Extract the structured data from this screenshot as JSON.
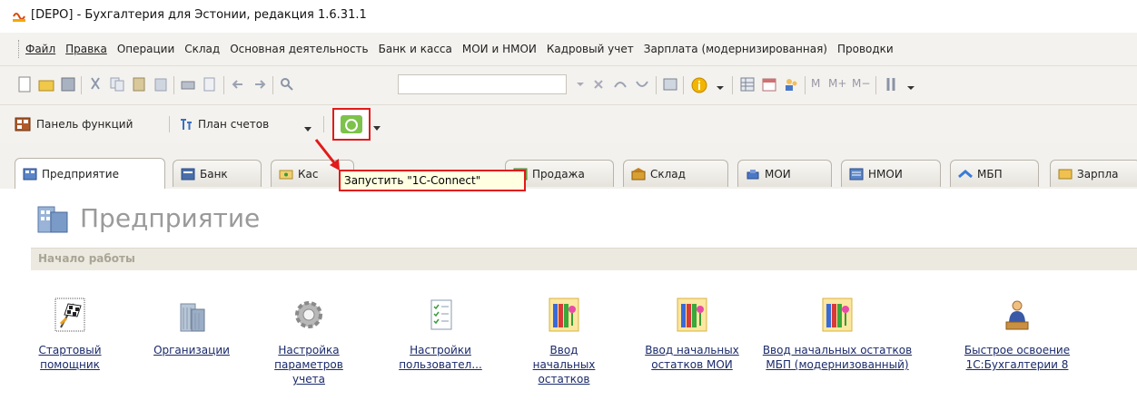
{
  "window": {
    "title": "[DEPO] - Бухгалтерия для Эстонии, редакция 1.6.31.1"
  },
  "menu": {
    "items": [
      "Файл",
      "Правка",
      "Операции",
      "Склад",
      "Основная деятельность",
      "Банк и касса",
      "МОИ и НМОИ",
      "Кадровый учет",
      "Зарплата (модернизированная)",
      "Проводки"
    ]
  },
  "toolbar": {
    "search_value": "",
    "m_buttons": [
      "M",
      "M+",
      "M−"
    ]
  },
  "funcbar": {
    "function_panel_label": "Панель функций",
    "chart_of_accounts_label": "План счетов"
  },
  "tooltip": {
    "text": "Запустить \"1С-Connect\""
  },
  "tabs": [
    {
      "label": "Предприятие",
      "active": true,
      "icon": "enterprise-icon"
    },
    {
      "label": "Банк",
      "active": false,
      "icon": "bank-icon"
    },
    {
      "label": "Кас",
      "active": false,
      "icon": "cash-icon"
    },
    {
      "label": "Продажа",
      "active": false,
      "icon": "sales-icon"
    },
    {
      "label": "Склад",
      "active": false,
      "icon": "warehouse-icon"
    },
    {
      "label": "МОИ",
      "active": false,
      "icon": "fixed-assets-icon"
    },
    {
      "label": "НМОИ",
      "active": false,
      "icon": "intangible-assets-icon"
    },
    {
      "label": "МБП",
      "active": false,
      "icon": "low-value-items-icon"
    },
    {
      "label": "Зарпла",
      "active": false,
      "icon": "salary-icon"
    }
  ],
  "content": {
    "section_title": "Предприятие",
    "start_bar": "Начало работы",
    "items": [
      {
        "label": "Стартовый помощник",
        "icon": "checkered-flag-icon"
      },
      {
        "label": "Организации",
        "icon": "building-icon"
      },
      {
        "label": "Настройка параметров учета",
        "icon": "gear-icon"
      },
      {
        "label": "Настройки пользовател...",
        "icon": "checklist-icon"
      },
      {
        "label": "Ввод начальных остатков",
        "icon": "books-icon"
      },
      {
        "label": "Ввод начальных остатков МОИ",
        "icon": "books-icon"
      },
      {
        "label": "Ввод начальных остатков МБП (модернизованный)",
        "icon": "books-icon"
      },
      {
        "label": "Быстрое освоение 1С:Бухгалтерии 8",
        "icon": "teacher-icon"
      }
    ]
  },
  "colors": {
    "highlight_red": "#e21a1a",
    "tooltip_bg": "#ffffe1",
    "panel_bg": "#f4f2ee",
    "link_blue": "#1a2a6a"
  }
}
